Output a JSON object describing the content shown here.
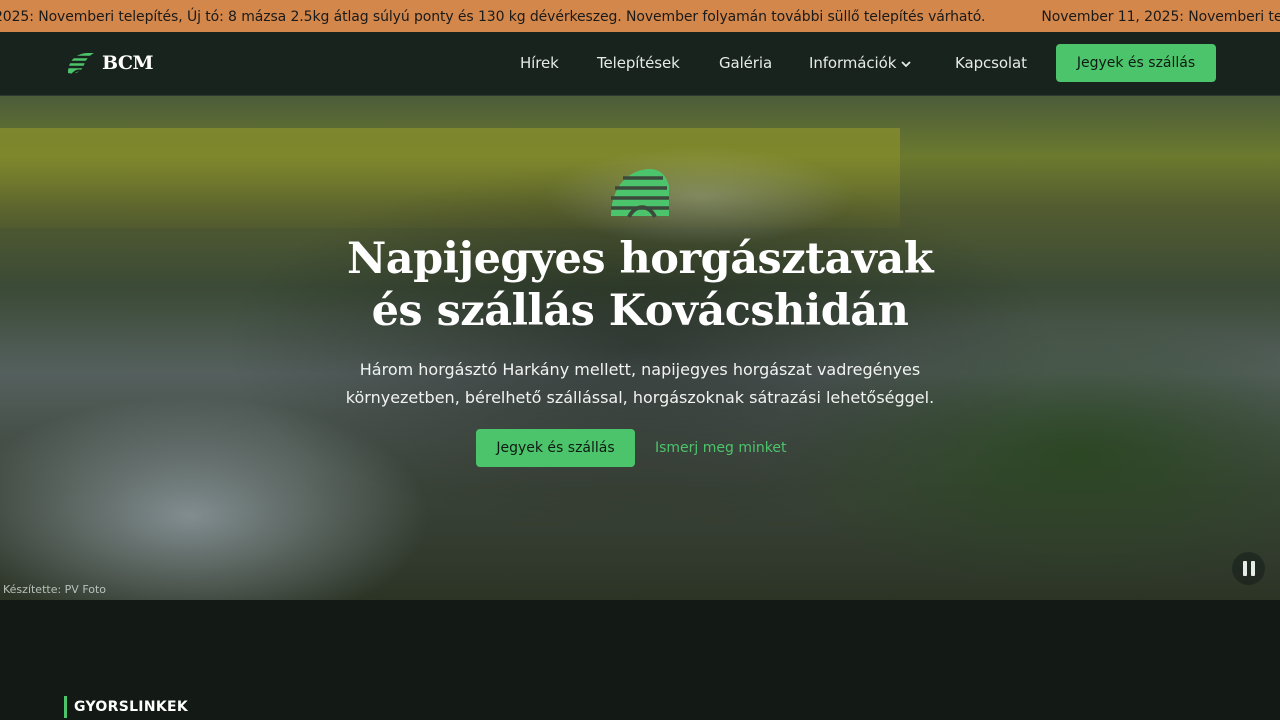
{
  "ticker": {
    "messages": [
      "2025: Novemberi telepítés, Új tó: 8 mázsa 2.5kg átlag súlyú ponty és 130 kg dévérkeszeg. November folyamán további süllő telepítés várható.",
      "November 11, 2025: Novemberi telep"
    ]
  },
  "nav": {
    "logo_text": "BCM",
    "items": [
      "Hírek",
      "Telepítések",
      "Galéria",
      "Információk",
      "Kapcsolat"
    ],
    "cta": "Jegyek és szállás"
  },
  "hero": {
    "title_line1": "Napijegyes horgásztavak",
    "title_line2": "és szállás Kovácshidán",
    "subtitle_line1": "Három horgásztó Harkány mellett, napijegyes horgászat vadregényes",
    "subtitle_line2": "környezetben, bérelhető szállással, horgászoknak sátrazási lehetőséggel.",
    "primary_button": "Jegyek és szállás",
    "secondary_link": "Ismerj meg minket",
    "photo_credit": "Készítette: PV Foto"
  },
  "quicklinks": {
    "label": "GYORSLINKEK"
  },
  "colors": {
    "accent": "#4cc46b",
    "ticker_bg": "#d4874a",
    "page_bg": "#131a16"
  },
  "icons": {
    "logo": "fish-leaf-logo-icon",
    "dropdown": "chevron-down-icon",
    "video": "pause-icon"
  }
}
